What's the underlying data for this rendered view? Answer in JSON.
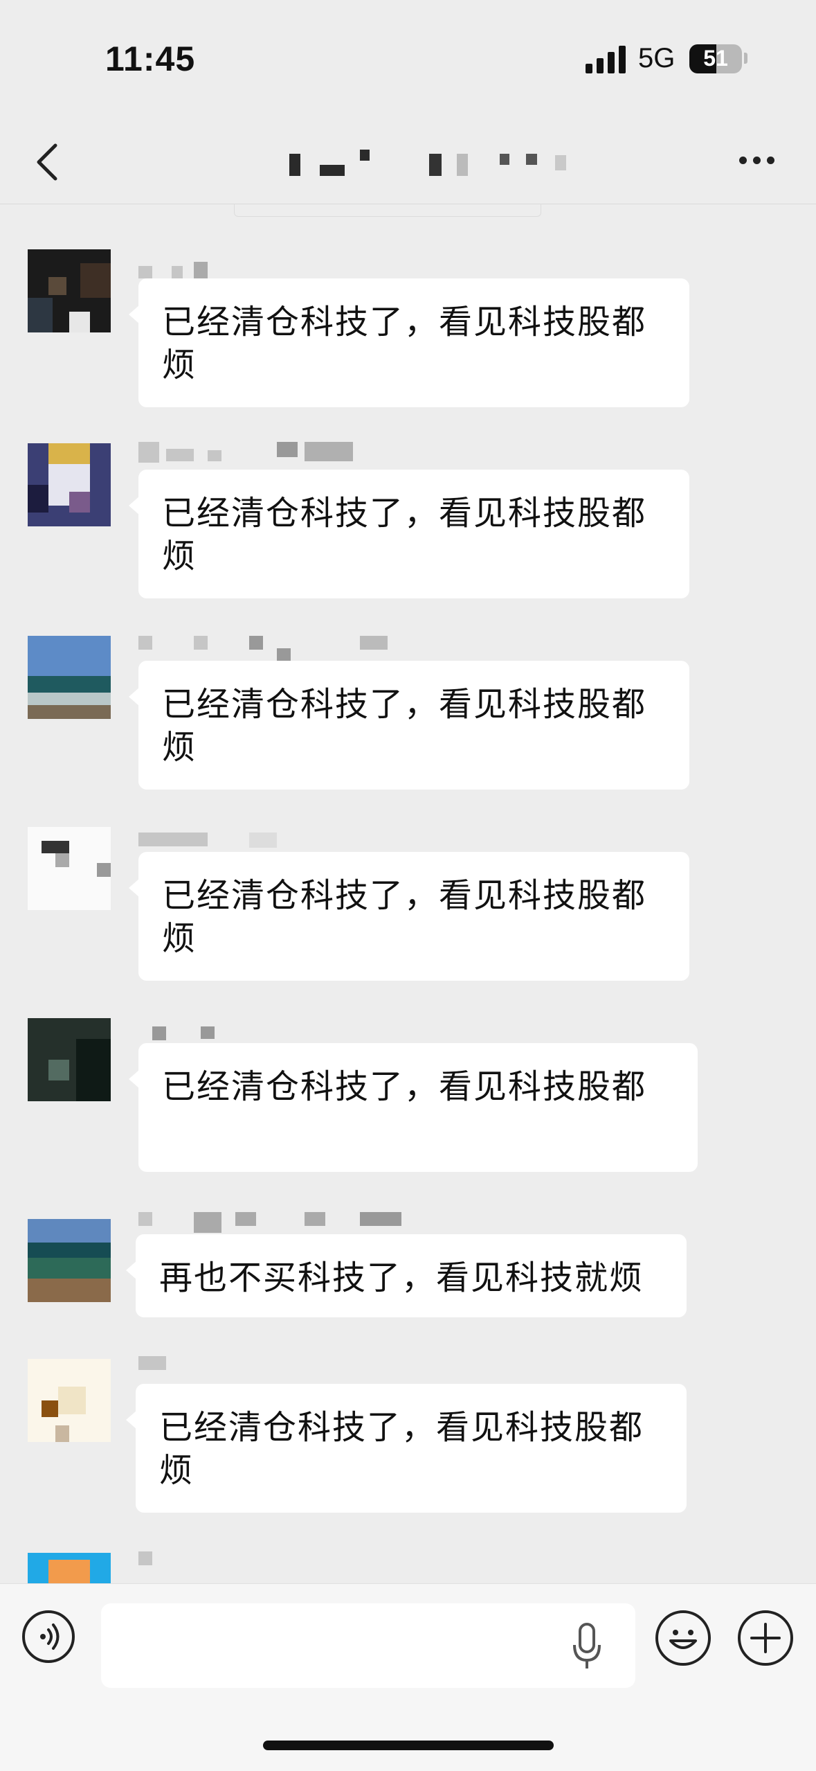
{
  "status_bar": {
    "time": "11:45",
    "network": "5G",
    "battery": "51",
    "battery_level": 0.51
  },
  "nav": {
    "back_icon": "chevron-left-icon",
    "more_icon": "more-dots-icon"
  },
  "messages": [
    {
      "text": "已经清仓科技了，看见科技股都烦"
    },
    {
      "text": "已经清仓科技了，看见科技股都烦"
    },
    {
      "text": "已经清仓科技了，看见科技股都烦"
    },
    {
      "text": "已经清仓科技了，看见科技股都烦"
    },
    {
      "text": "已经清仓科技了，看见科技股都"
    },
    {
      "text": "再也不买科技了，看见科技就烦"
    },
    {
      "text": "已经清仓科技了，看见科技股都烦"
    }
  ],
  "colors": {
    "background": "#ededed",
    "bubble": "#ffffff",
    "text": "#111111"
  },
  "input_bar": {
    "voice_icon": "voice-icon",
    "mic_icon": "microphone-icon",
    "emoji_icon": "emoji-icon",
    "plus_icon": "plus-icon"
  }
}
